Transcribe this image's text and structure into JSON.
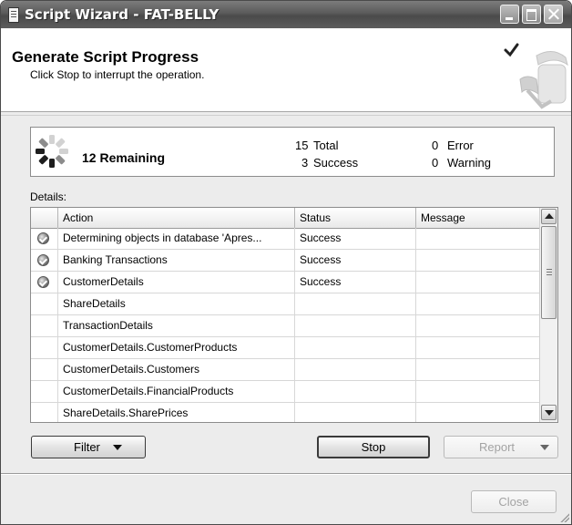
{
  "window": {
    "title": "Script Wizard - FAT-BELLY"
  },
  "header": {
    "title": "Generate Script Progress",
    "subtitle": "Click Stop to interrupt the operation."
  },
  "status": {
    "remaining": "12 Remaining",
    "total_count": "15",
    "total_label": "Total",
    "success_count": "3",
    "success_label": "Success",
    "error_count": "0",
    "error_label": "Error",
    "warning_count": "0",
    "warning_label": "Warning"
  },
  "details": {
    "label": "Details:",
    "columns": [
      "Action",
      "Status",
      "Message"
    ],
    "rows": [
      {
        "icon": "success-icon",
        "action": "Determining objects in database 'Apres...",
        "status": "Success",
        "message": ""
      },
      {
        "icon": "success-icon",
        "action": "Banking Transactions",
        "status": "Success",
        "message": ""
      },
      {
        "icon": "success-icon",
        "action": "CustomerDetails",
        "status": "Success",
        "message": ""
      },
      {
        "icon": "",
        "action": "ShareDetails",
        "status": "",
        "message": ""
      },
      {
        "icon": "",
        "action": "TransactionDetails",
        "status": "",
        "message": ""
      },
      {
        "icon": "",
        "action": "CustomerDetails.CustomerProducts",
        "status": "",
        "message": ""
      },
      {
        "icon": "",
        "action": "CustomerDetails.Customers",
        "status": "",
        "message": ""
      },
      {
        "icon": "",
        "action": "CustomerDetails.FinancialProducts",
        "status": "",
        "message": ""
      },
      {
        "icon": "",
        "action": "ShareDetails.SharePrices",
        "status": "",
        "message": ""
      }
    ]
  },
  "buttons": {
    "filter": "Filter",
    "stop": "Stop",
    "report": "Report",
    "close": "Close"
  },
  "colors": {
    "title_bar": "#5a5a5a",
    "dialog_bg": "#ececec",
    "header_bg": "#ffffff",
    "border": "#8c8c8c"
  }
}
